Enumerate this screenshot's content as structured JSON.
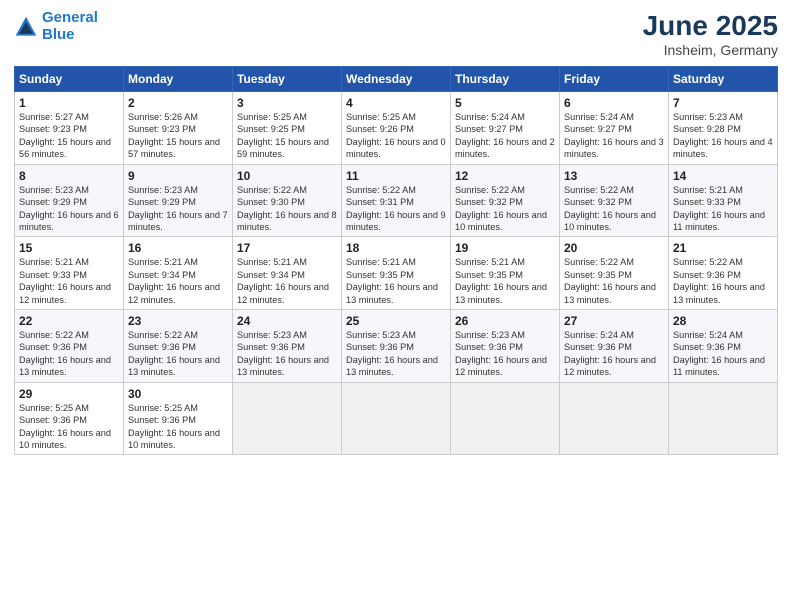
{
  "header": {
    "logo_line1": "General",
    "logo_line2": "Blue",
    "month_year": "June 2025",
    "location": "Insheim, Germany"
  },
  "weekdays": [
    "Sunday",
    "Monday",
    "Tuesday",
    "Wednesday",
    "Thursday",
    "Friday",
    "Saturday"
  ],
  "weeks": [
    [
      {
        "day": "1",
        "sunrise": "Sunrise: 5:27 AM",
        "sunset": "Sunset: 9:23 PM",
        "daylight": "Daylight: 15 hours and 56 minutes."
      },
      {
        "day": "2",
        "sunrise": "Sunrise: 5:26 AM",
        "sunset": "Sunset: 9:23 PM",
        "daylight": "Daylight: 15 hours and 57 minutes."
      },
      {
        "day": "3",
        "sunrise": "Sunrise: 5:25 AM",
        "sunset": "Sunset: 9:25 PM",
        "daylight": "Daylight: 15 hours and 59 minutes."
      },
      {
        "day": "4",
        "sunrise": "Sunrise: 5:25 AM",
        "sunset": "Sunset: 9:26 PM",
        "daylight": "Daylight: 16 hours and 0 minutes."
      },
      {
        "day": "5",
        "sunrise": "Sunrise: 5:24 AM",
        "sunset": "Sunset: 9:27 PM",
        "daylight": "Daylight: 16 hours and 2 minutes."
      },
      {
        "day": "6",
        "sunrise": "Sunrise: 5:24 AM",
        "sunset": "Sunset: 9:27 PM",
        "daylight": "Daylight: 16 hours and 3 minutes."
      },
      {
        "day": "7",
        "sunrise": "Sunrise: 5:23 AM",
        "sunset": "Sunset: 9:28 PM",
        "daylight": "Daylight: 16 hours and 4 minutes."
      }
    ],
    [
      {
        "day": "8",
        "sunrise": "Sunrise: 5:23 AM",
        "sunset": "Sunset: 9:29 PM",
        "daylight": "Daylight: 16 hours and 6 minutes."
      },
      {
        "day": "9",
        "sunrise": "Sunrise: 5:23 AM",
        "sunset": "Sunset: 9:29 PM",
        "daylight": "Daylight: 16 hours and 7 minutes."
      },
      {
        "day": "10",
        "sunrise": "Sunrise: 5:22 AM",
        "sunset": "Sunset: 9:30 PM",
        "daylight": "Daylight: 16 hours and 8 minutes."
      },
      {
        "day": "11",
        "sunrise": "Sunrise: 5:22 AM",
        "sunset": "Sunset: 9:31 PM",
        "daylight": "Daylight: 16 hours and 9 minutes."
      },
      {
        "day": "12",
        "sunrise": "Sunrise: 5:22 AM",
        "sunset": "Sunset: 9:32 PM",
        "daylight": "Daylight: 16 hours and 10 minutes."
      },
      {
        "day": "13",
        "sunrise": "Sunrise: 5:22 AM",
        "sunset": "Sunset: 9:32 PM",
        "daylight": "Daylight: 16 hours and 10 minutes."
      },
      {
        "day": "14",
        "sunrise": "Sunrise: 5:21 AM",
        "sunset": "Sunset: 9:33 PM",
        "daylight": "Daylight: 16 hours and 11 minutes."
      }
    ],
    [
      {
        "day": "15",
        "sunrise": "Sunrise: 5:21 AM",
        "sunset": "Sunset: 9:33 PM",
        "daylight": "Daylight: 16 hours and 12 minutes."
      },
      {
        "day": "16",
        "sunrise": "Sunrise: 5:21 AM",
        "sunset": "Sunset: 9:34 PM",
        "daylight": "Daylight: 16 hours and 12 minutes."
      },
      {
        "day": "17",
        "sunrise": "Sunrise: 5:21 AM",
        "sunset": "Sunset: 9:34 PM",
        "daylight": "Daylight: 16 hours and 12 minutes."
      },
      {
        "day": "18",
        "sunrise": "Sunrise: 5:21 AM",
        "sunset": "Sunset: 9:35 PM",
        "daylight": "Daylight: 16 hours and 13 minutes."
      },
      {
        "day": "19",
        "sunrise": "Sunrise: 5:21 AM",
        "sunset": "Sunset: 9:35 PM",
        "daylight": "Daylight: 16 hours and 13 minutes."
      },
      {
        "day": "20",
        "sunrise": "Sunrise: 5:22 AM",
        "sunset": "Sunset: 9:35 PM",
        "daylight": "Daylight: 16 hours and 13 minutes."
      },
      {
        "day": "21",
        "sunrise": "Sunrise: 5:22 AM",
        "sunset": "Sunset: 9:36 PM",
        "daylight": "Daylight: 16 hours and 13 minutes."
      }
    ],
    [
      {
        "day": "22",
        "sunrise": "Sunrise: 5:22 AM",
        "sunset": "Sunset: 9:36 PM",
        "daylight": "Daylight: 16 hours and 13 minutes."
      },
      {
        "day": "23",
        "sunrise": "Sunrise: 5:22 AM",
        "sunset": "Sunset: 9:36 PM",
        "daylight": "Daylight: 16 hours and 13 minutes."
      },
      {
        "day": "24",
        "sunrise": "Sunrise: 5:23 AM",
        "sunset": "Sunset: 9:36 PM",
        "daylight": "Daylight: 16 hours and 13 minutes."
      },
      {
        "day": "25",
        "sunrise": "Sunrise: 5:23 AM",
        "sunset": "Sunset: 9:36 PM",
        "daylight": "Daylight: 16 hours and 13 minutes."
      },
      {
        "day": "26",
        "sunrise": "Sunrise: 5:23 AM",
        "sunset": "Sunset: 9:36 PM",
        "daylight": "Daylight: 16 hours and 12 minutes."
      },
      {
        "day": "27",
        "sunrise": "Sunrise: 5:24 AM",
        "sunset": "Sunset: 9:36 PM",
        "daylight": "Daylight: 16 hours and 12 minutes."
      },
      {
        "day": "28",
        "sunrise": "Sunrise: 5:24 AM",
        "sunset": "Sunset: 9:36 PM",
        "daylight": "Daylight: 16 hours and 11 minutes."
      }
    ],
    [
      {
        "day": "29",
        "sunrise": "Sunrise: 5:25 AM",
        "sunset": "Sunset: 9:36 PM",
        "daylight": "Daylight: 16 hours and 10 minutes."
      },
      {
        "day": "30",
        "sunrise": "Sunrise: 5:25 AM",
        "sunset": "Sunset: 9:36 PM",
        "daylight": "Daylight: 16 hours and 10 minutes."
      },
      null,
      null,
      null,
      null,
      null
    ]
  ]
}
